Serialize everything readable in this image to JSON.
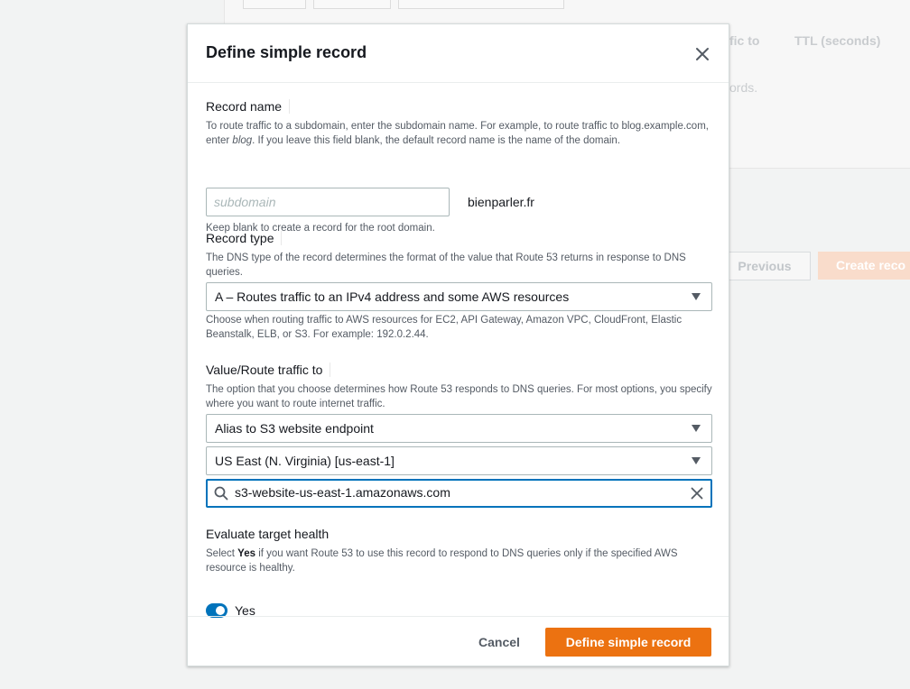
{
  "background": {
    "col_header_route": "fic to",
    "col_header_ttl": "TTL (seconds)",
    "records_fragment": "ords.",
    "previous_label": "Previous",
    "create_label": "Create reco"
  },
  "modal": {
    "title": "Define simple record",
    "close_icon": "close-icon",
    "record_name": {
      "label": "Record name",
      "desc_part1": "To route traffic to a subdomain, enter the subdomain name. For example, to route traffic to blog.example.com, enter ",
      "desc_em": "blog",
      "desc_part2": ". If you leave this field blank, the default record name is the name of the domain.",
      "placeholder": "subdomain",
      "value": "",
      "domain_suffix": "bienparler.fr",
      "hint": "Keep blank to create a record for the root domain."
    },
    "record_type": {
      "label": "Record type",
      "desc": "The DNS type of the record determines the format of the value that Route 53 returns in response to DNS queries.",
      "selected": "A – Routes traffic to an IPv4 address and some AWS resources",
      "hint": "Choose when routing traffic to AWS resources for EC2, API Gateway, Amazon VPC, CloudFront, Elastic Beanstalk, ELB, or S3. For example: 192.0.2.44."
    },
    "value_route": {
      "label": "Value/Route traffic to",
      "desc": "The option that you choose determines how Route 53 responds to DNS queries. For most options, you specify where you want to route internet traffic.",
      "endpoint_selected": "Alias to S3 website endpoint",
      "region_selected": "US East (N. Virginia) [us-east-1]",
      "search_value": "s3-website-us-east-1.amazonaws.com",
      "search_icon": "search-icon",
      "clear_icon": "clear-icon"
    },
    "evaluate_health": {
      "label": "Evaluate target health",
      "desc_part1": "Select ",
      "desc_bold": "Yes",
      "desc_part2": " if you want Route 53 to use this record to respond to DNS queries only if the specified AWS resource is healthy.",
      "toggle_on": true,
      "toggle_label": "Yes"
    },
    "footer": {
      "cancel_label": "Cancel",
      "submit_label": "Define simple record"
    }
  },
  "colors": {
    "primary": "#ec7211",
    "accent": "#0073bb",
    "background": "#f2f3f3"
  }
}
